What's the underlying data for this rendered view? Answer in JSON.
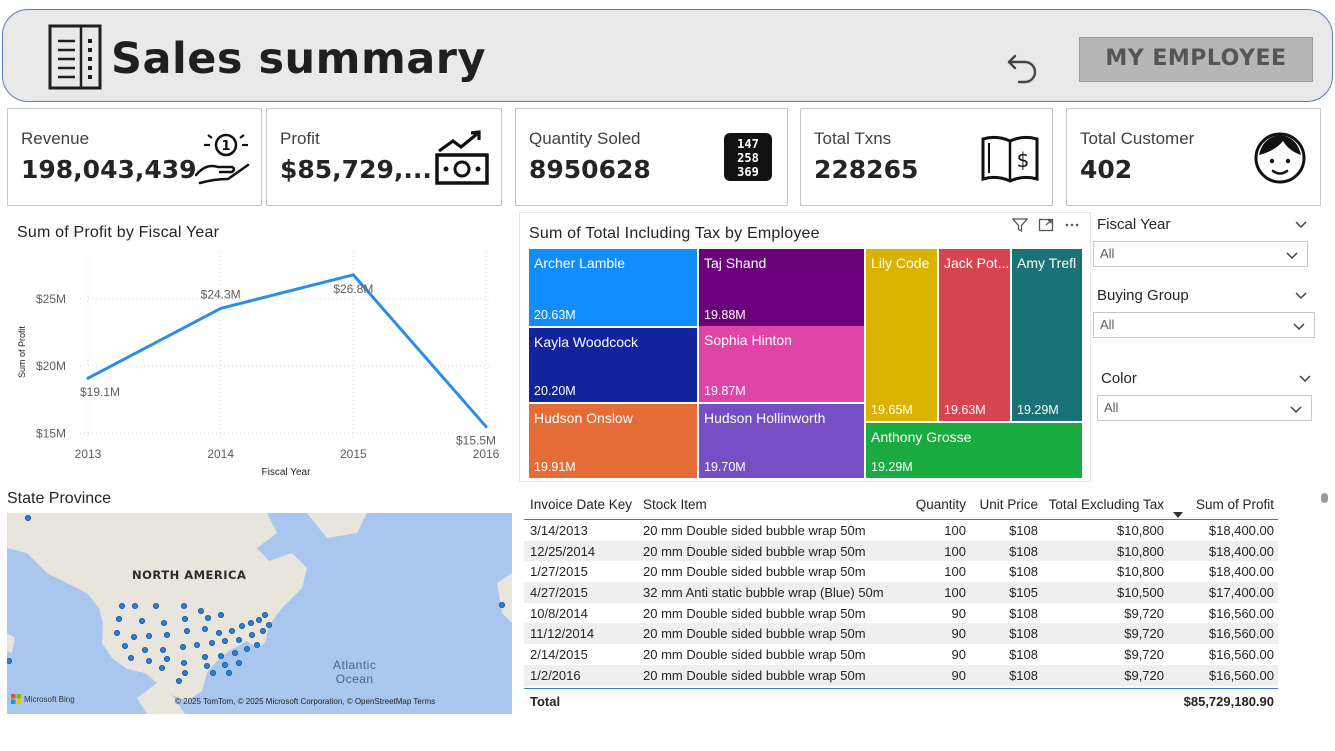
{
  "header": {
    "title": "Sales summary",
    "employee_button": "MY EMPLOYEE"
  },
  "kpis": [
    {
      "label": "Revenue",
      "value": "198,043,439",
      "icon": "money-hand-icon"
    },
    {
      "label": "Profit",
      "value": "$85,729,...",
      "icon": "cash-growth-icon"
    },
    {
      "label": "Quantity Soled",
      "value": "8950628",
      "icon": "number-grid-icon"
    },
    {
      "label": "Total Txns",
      "value": "228265",
      "icon": "dollar-book-icon"
    },
    {
      "label": "Total Customer",
      "value": "402",
      "icon": "customer-face-icon"
    }
  ],
  "profit_chart": {
    "title": "Sum of Profit by Fiscal Year"
  },
  "treemap": {
    "title": "Sum of Total Including Tax by Employee"
  },
  "slicers": [
    {
      "label": "Fiscal Year",
      "value": "All"
    },
    {
      "label": "Buying Group",
      "value": "All"
    },
    {
      "label": "Color",
      "value": "All"
    }
  ],
  "map": {
    "title": "State Province",
    "continent_label": "NORTH AMERICA",
    "ocean_label_1": "Atlantic",
    "ocean_label_2": "Ocean",
    "credit": "© 2025 TomTom, © 2025 Microsoft Corporation, © OpenStreetMap  Terms",
    "provider": "Microsoft Bing"
  },
  "table": {
    "columns": [
      "Invoice Date Key",
      "Stock Item",
      "Quantity",
      "Unit Price",
      "Total Excluding Tax",
      "Sum of Profit"
    ],
    "rows": [
      [
        "3/14/2013",
        "20 mm Double sided bubble wrap 50m",
        "100",
        "$108",
        "$10,800",
        "$18,400.00"
      ],
      [
        "12/25/2014",
        "20 mm Double sided bubble wrap 50m",
        "100",
        "$108",
        "$10,800",
        "$18,400.00"
      ],
      [
        "1/27/2015",
        "20 mm Double sided bubble wrap 50m",
        "100",
        "$108",
        "$10,800",
        "$18,400.00"
      ],
      [
        "4/27/2015",
        "32 mm Anti static bubble wrap (Blue) 50m",
        "100",
        "$105",
        "$10,500",
        "$17,400.00"
      ],
      [
        "10/8/2014",
        "20 mm Double sided bubble wrap 50m",
        "90",
        "$108",
        "$9,720",
        "$16,560.00"
      ],
      [
        "11/12/2014",
        "20 mm Double sided bubble wrap 50m",
        "90",
        "$108",
        "$9,720",
        "$16,560.00"
      ],
      [
        "2/14/2015",
        "20 mm Double sided bubble wrap 50m",
        "90",
        "$108",
        "$9,720",
        "$16,560.00"
      ],
      [
        "1/2/2016",
        "20 mm Double sided bubble wrap 50m",
        "90",
        "$108",
        "$9,720",
        "$16,560.00"
      ]
    ],
    "total_label": "Total",
    "total_value": "$85,729,180.90"
  },
  "chart_data": [
    {
      "type": "line",
      "title": "Sum of Profit by Fiscal Year",
      "xlabel": "Fiscal Year",
      "ylabel": "Sum of Profit",
      "x": [
        "2013",
        "2014",
        "2015",
        "2016"
      ],
      "values": [
        19.1,
        24.3,
        26.8,
        15.5
      ],
      "data_labels": [
        "$19.1M",
        "$24.3M",
        "$26.8M",
        "$15.5M"
      ],
      "yticks": [
        15,
        20,
        25
      ],
      "ytick_labels": [
        "$15M",
        "$20M",
        "$25M"
      ],
      "ylim": [
        14.5,
        28.5
      ],
      "color": "#2b8de8",
      "grid": true
    },
    {
      "type": "treemap",
      "title": "Sum of Total Including Tax by Employee",
      "items": [
        {
          "name": "Archer Lamble",
          "value": 20.63,
          "label": "20.63M",
          "color": "#118dff"
        },
        {
          "name": "Kayla Woodcock",
          "value": 20.2,
          "label": "20.20M",
          "color": "#12239e"
        },
        {
          "name": "Hudson Onslow",
          "value": 19.91,
          "label": "19.91M",
          "color": "#e66c37"
        },
        {
          "name": "Taj Shand",
          "value": 19.88,
          "label": "19.88M",
          "color": "#6b007b"
        },
        {
          "name": "Sophia Hinton",
          "value": 19.87,
          "label": "19.87M",
          "color": "#e044a7"
        },
        {
          "name": "Hudson Hollinworth",
          "value": 19.7,
          "label": "19.70M",
          "color": "#744ec2"
        },
        {
          "name": "Lily Code",
          "value": 19.65,
          "label": "19.65M",
          "color": "#d9b300"
        },
        {
          "name": "Jack Pot...",
          "value": 19.63,
          "label": "19.63M",
          "color": "#d64550"
        },
        {
          "name": "Amy Trefl",
          "value": 19.29,
          "label": "19.29M",
          "color": "#197278"
        },
        {
          "name": "Anthony Grosse",
          "value": 19.29,
          "label": "19.29M",
          "color": "#1aab40"
        }
      ]
    }
  ]
}
